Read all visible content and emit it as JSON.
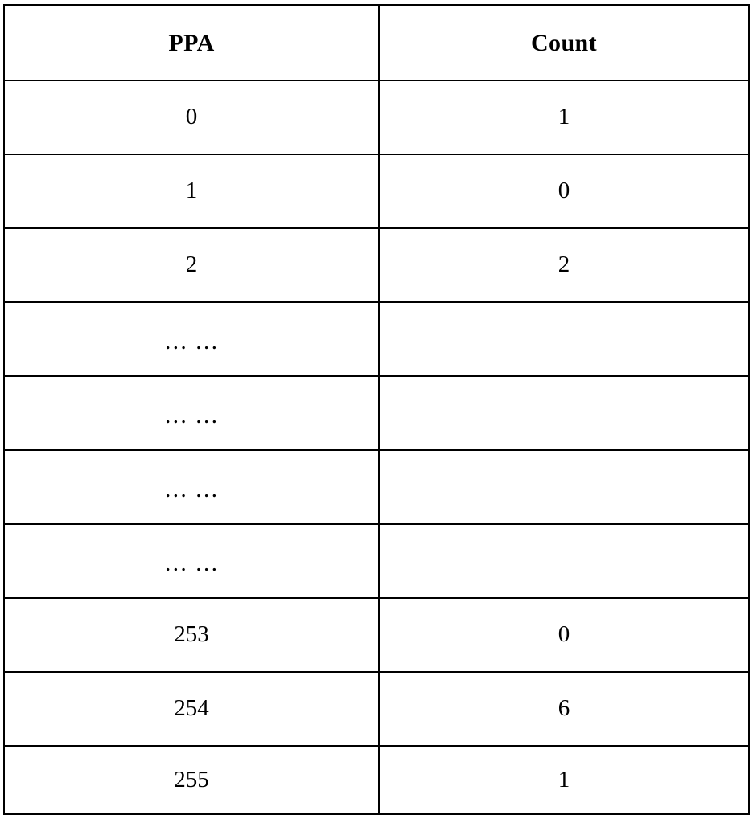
{
  "table": {
    "columns": [
      {
        "key": "ppa",
        "label": "PPA"
      },
      {
        "key": "count",
        "label": "Count"
      }
    ],
    "rows": [
      {
        "ppa": "0",
        "count": "1"
      },
      {
        "ppa": "1",
        "count": "0"
      },
      {
        "ppa": "2",
        "count": "2"
      },
      {
        "ppa": "… …",
        "count": ""
      },
      {
        "ppa": "… …",
        "count": ""
      },
      {
        "ppa": "… …",
        "count": ""
      },
      {
        "ppa": "… …",
        "count": ""
      },
      {
        "ppa": "253",
        "count": "0"
      },
      {
        "ppa": "254",
        "count": "6"
      },
      {
        "ppa": "255",
        "count": "1"
      }
    ]
  },
  "colors": {
    "border": "#000000",
    "text": "#000000",
    "background": "#ffffff"
  }
}
